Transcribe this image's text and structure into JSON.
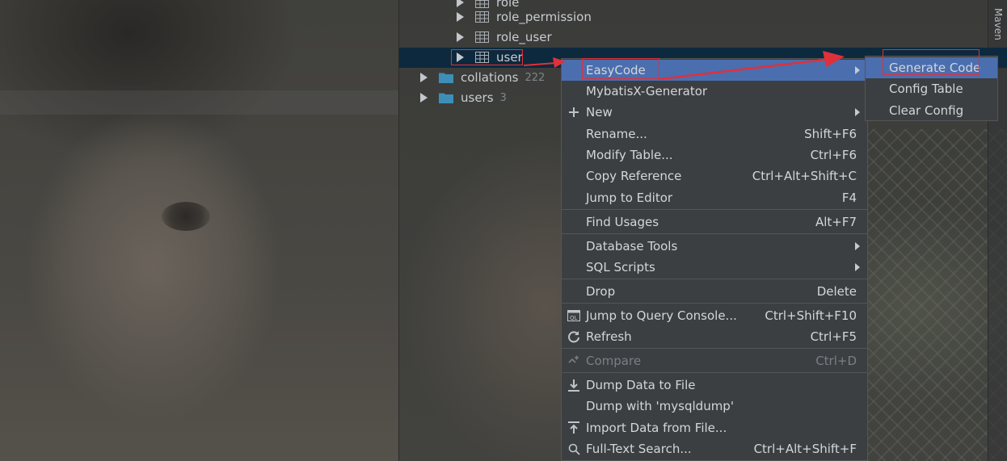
{
  "tree": {
    "items": [
      {
        "label": "role",
        "icon": "table-icon"
      },
      {
        "label": "role_permission",
        "icon": "table-icon"
      },
      {
        "label": "role_user",
        "icon": "table-icon"
      },
      {
        "label": "user",
        "icon": "table-icon"
      },
      {
        "label": "collations",
        "count": "222",
        "icon": "folder-icon"
      },
      {
        "label": "users",
        "count": "3",
        "icon": "folder-icon"
      }
    ]
  },
  "side_panel": {
    "maven_label": "Maven"
  },
  "context_menu": {
    "items": [
      {
        "label": "EasyCode",
        "shortcut": "",
        "submenu": true
      },
      {
        "label": "MybatisX-Generator",
        "shortcut": ""
      },
      {
        "label": "New",
        "shortcut": "",
        "submenu": true
      },
      {
        "label": "Rename...",
        "shortcut": "Shift+F6"
      },
      {
        "label": "Modify Table...",
        "shortcut": "Ctrl+F6"
      },
      {
        "label": "Copy Reference",
        "shortcut": "Ctrl+Alt+Shift+C"
      },
      {
        "label": "Jump to Editor",
        "shortcut": "F4"
      },
      {
        "label": "Find Usages",
        "shortcut": "Alt+F7"
      },
      {
        "label": "Database Tools",
        "shortcut": "",
        "submenu": true
      },
      {
        "label": "SQL Scripts",
        "shortcut": "",
        "submenu": true
      },
      {
        "label": "Drop",
        "shortcut": "Delete"
      },
      {
        "label": "Jump to Query Console...",
        "shortcut": "Ctrl+Shift+F10"
      },
      {
        "label": "Refresh",
        "shortcut": "Ctrl+F5"
      },
      {
        "label": "Compare",
        "shortcut": "Ctrl+D"
      },
      {
        "label": "Dump Data to File",
        "shortcut": ""
      },
      {
        "label": "Dump with 'mysqldump'",
        "shortcut": ""
      },
      {
        "label": "Import Data from File...",
        "shortcut": ""
      },
      {
        "label": "Full-Text Search...",
        "shortcut": "Ctrl+Alt+Shift+F"
      }
    ]
  },
  "easycode_submenu": {
    "items": [
      {
        "label": "Generate Code"
      },
      {
        "label": "Config Table"
      },
      {
        "label": "Clear Config"
      }
    ]
  },
  "colors": {
    "menu_bg": "#3c3f41",
    "highlight": "#4b6eaf",
    "selection": "#0d293e",
    "annotation_red": "#e0303a"
  }
}
